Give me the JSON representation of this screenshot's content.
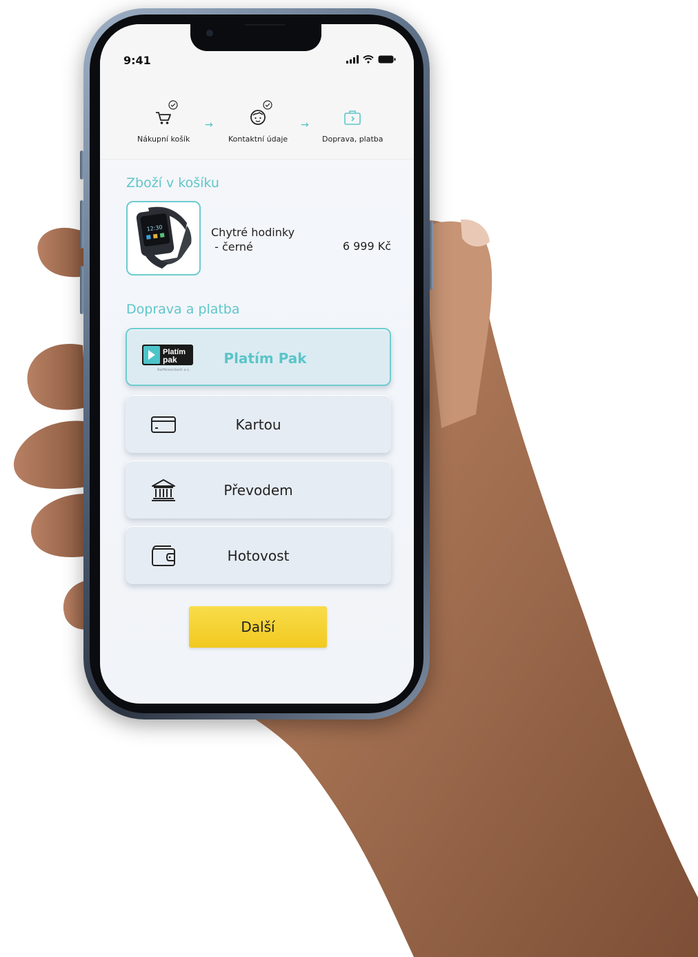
{
  "status_bar": {
    "time": "9:41"
  },
  "stepper": {
    "steps": [
      {
        "label": "Nákupní košík",
        "icon": "cart-icon",
        "done": true
      },
      {
        "label": "Kontaktní údaje",
        "icon": "face-icon",
        "done": true
      },
      {
        "label": "Doprava, platba",
        "icon": "briefcase-icon",
        "done": false
      }
    ],
    "arrow_glyph": "→"
  },
  "cart": {
    "title": "Zboží v košíku",
    "item": {
      "name_line1": "Chytré hodinky",
      "name_line2": " - černé",
      "price": "6 999 Kč",
      "image": "smartwatch-image"
    }
  },
  "payment": {
    "title": "Doprava a platba",
    "options": [
      {
        "label": "Platím Pak",
        "icon": "platim-pak-logo",
        "selected": true
      },
      {
        "label": "Kartou",
        "icon": "credit-card-icon",
        "selected": false
      },
      {
        "label": "Převodem",
        "icon": "bank-icon",
        "selected": false
      },
      {
        "label": "Hotovost",
        "icon": "wallet-icon",
        "selected": false
      }
    ],
    "logo": {
      "line1": "Platím",
      "line2": "pak",
      "sub": "Raiffeisenbank a.s."
    }
  },
  "next_button": {
    "label": "Další"
  },
  "colors": {
    "accent": "#5fc6ca",
    "button": "#f2c920",
    "option_bg": "#e6ecf4"
  }
}
